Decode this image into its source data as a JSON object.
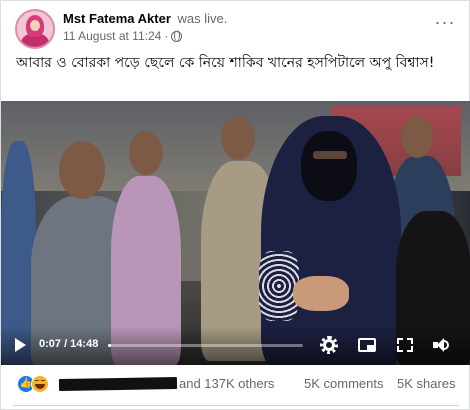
{
  "post": {
    "author": "Mst Fatema Akter",
    "status": "was live.",
    "date": "11 August at 11:24",
    "separator": "·",
    "more_label": "···",
    "caption": "আবার ও বোরকা পড়ে ছেলে কে নিয়ে শাকিব খানের হসপিটালে অপু বিশ্বাস!"
  },
  "video": {
    "current_time": "0:07",
    "duration": "14:48",
    "time_display": "0:07 / 14:48",
    "progress": 0.008
  },
  "engagement": {
    "reactions_text": "and 137K others",
    "comments": "5K comments",
    "shares": "5K shares",
    "reaction_types": [
      "like",
      "haha"
    ]
  },
  "colors": {
    "accent": "#1877f2",
    "secondary_text": "#65676b"
  }
}
